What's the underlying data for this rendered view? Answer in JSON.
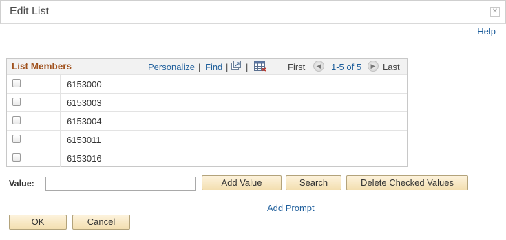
{
  "dialog": {
    "title": "Edit List",
    "close_icon": "close-icon",
    "help_label": "Help"
  },
  "grid": {
    "title": "List Members",
    "personalize": "Personalize",
    "find": "Find",
    "first": "First",
    "range": "1-5 of 5",
    "last": "Last",
    "rows": [
      {
        "value": "6153000"
      },
      {
        "value": "6153003"
      },
      {
        "value": "6153004"
      },
      {
        "value": "6153011"
      },
      {
        "value": "6153016"
      }
    ]
  },
  "form": {
    "value_label": "Value:",
    "value_input": "",
    "add_value": "Add Value",
    "search": "Search",
    "delete_checked": "Delete Checked Values",
    "add_prompt": "Add Prompt"
  },
  "footer": {
    "ok": "OK",
    "cancel": "Cancel"
  },
  "colors": {
    "accent_link": "#1f5f9c",
    "grid_title": "#a0521e",
    "button_bg": "#f3dfb0"
  }
}
